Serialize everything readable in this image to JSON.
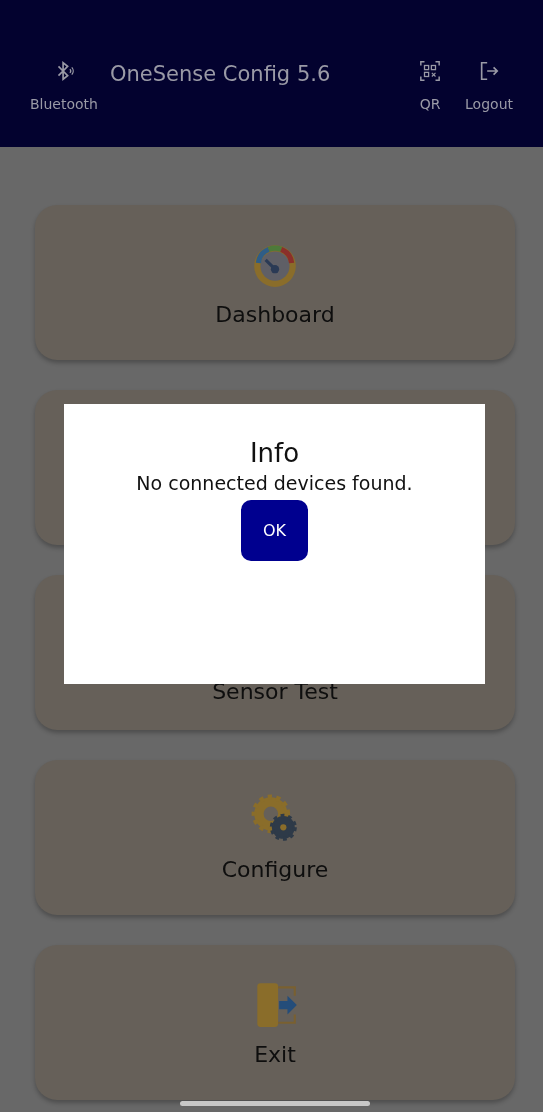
{
  "header": {
    "title": "OneSense Config 5.6",
    "left_action": {
      "label": "Bluetooth",
      "kind": "bluetooth"
    },
    "right_actions": [
      {
        "label": "QR",
        "kind": "qr"
      },
      {
        "label": "Logout",
        "kind": "logout"
      }
    ]
  },
  "menu_cards": [
    {
      "label": "Dashboard",
      "kind": "gauge"
    },
    {
      "kind": "hidden"
    },
    {
      "label": "Sensor Test",
      "kind": "hidden"
    },
    {
      "label": "Configure",
      "kind": "gears"
    },
    {
      "label": "Exit",
      "kind": "exit"
    }
  ],
  "dialog": {
    "title": "Info",
    "message": "No connected devices found.",
    "button": "OK"
  }
}
